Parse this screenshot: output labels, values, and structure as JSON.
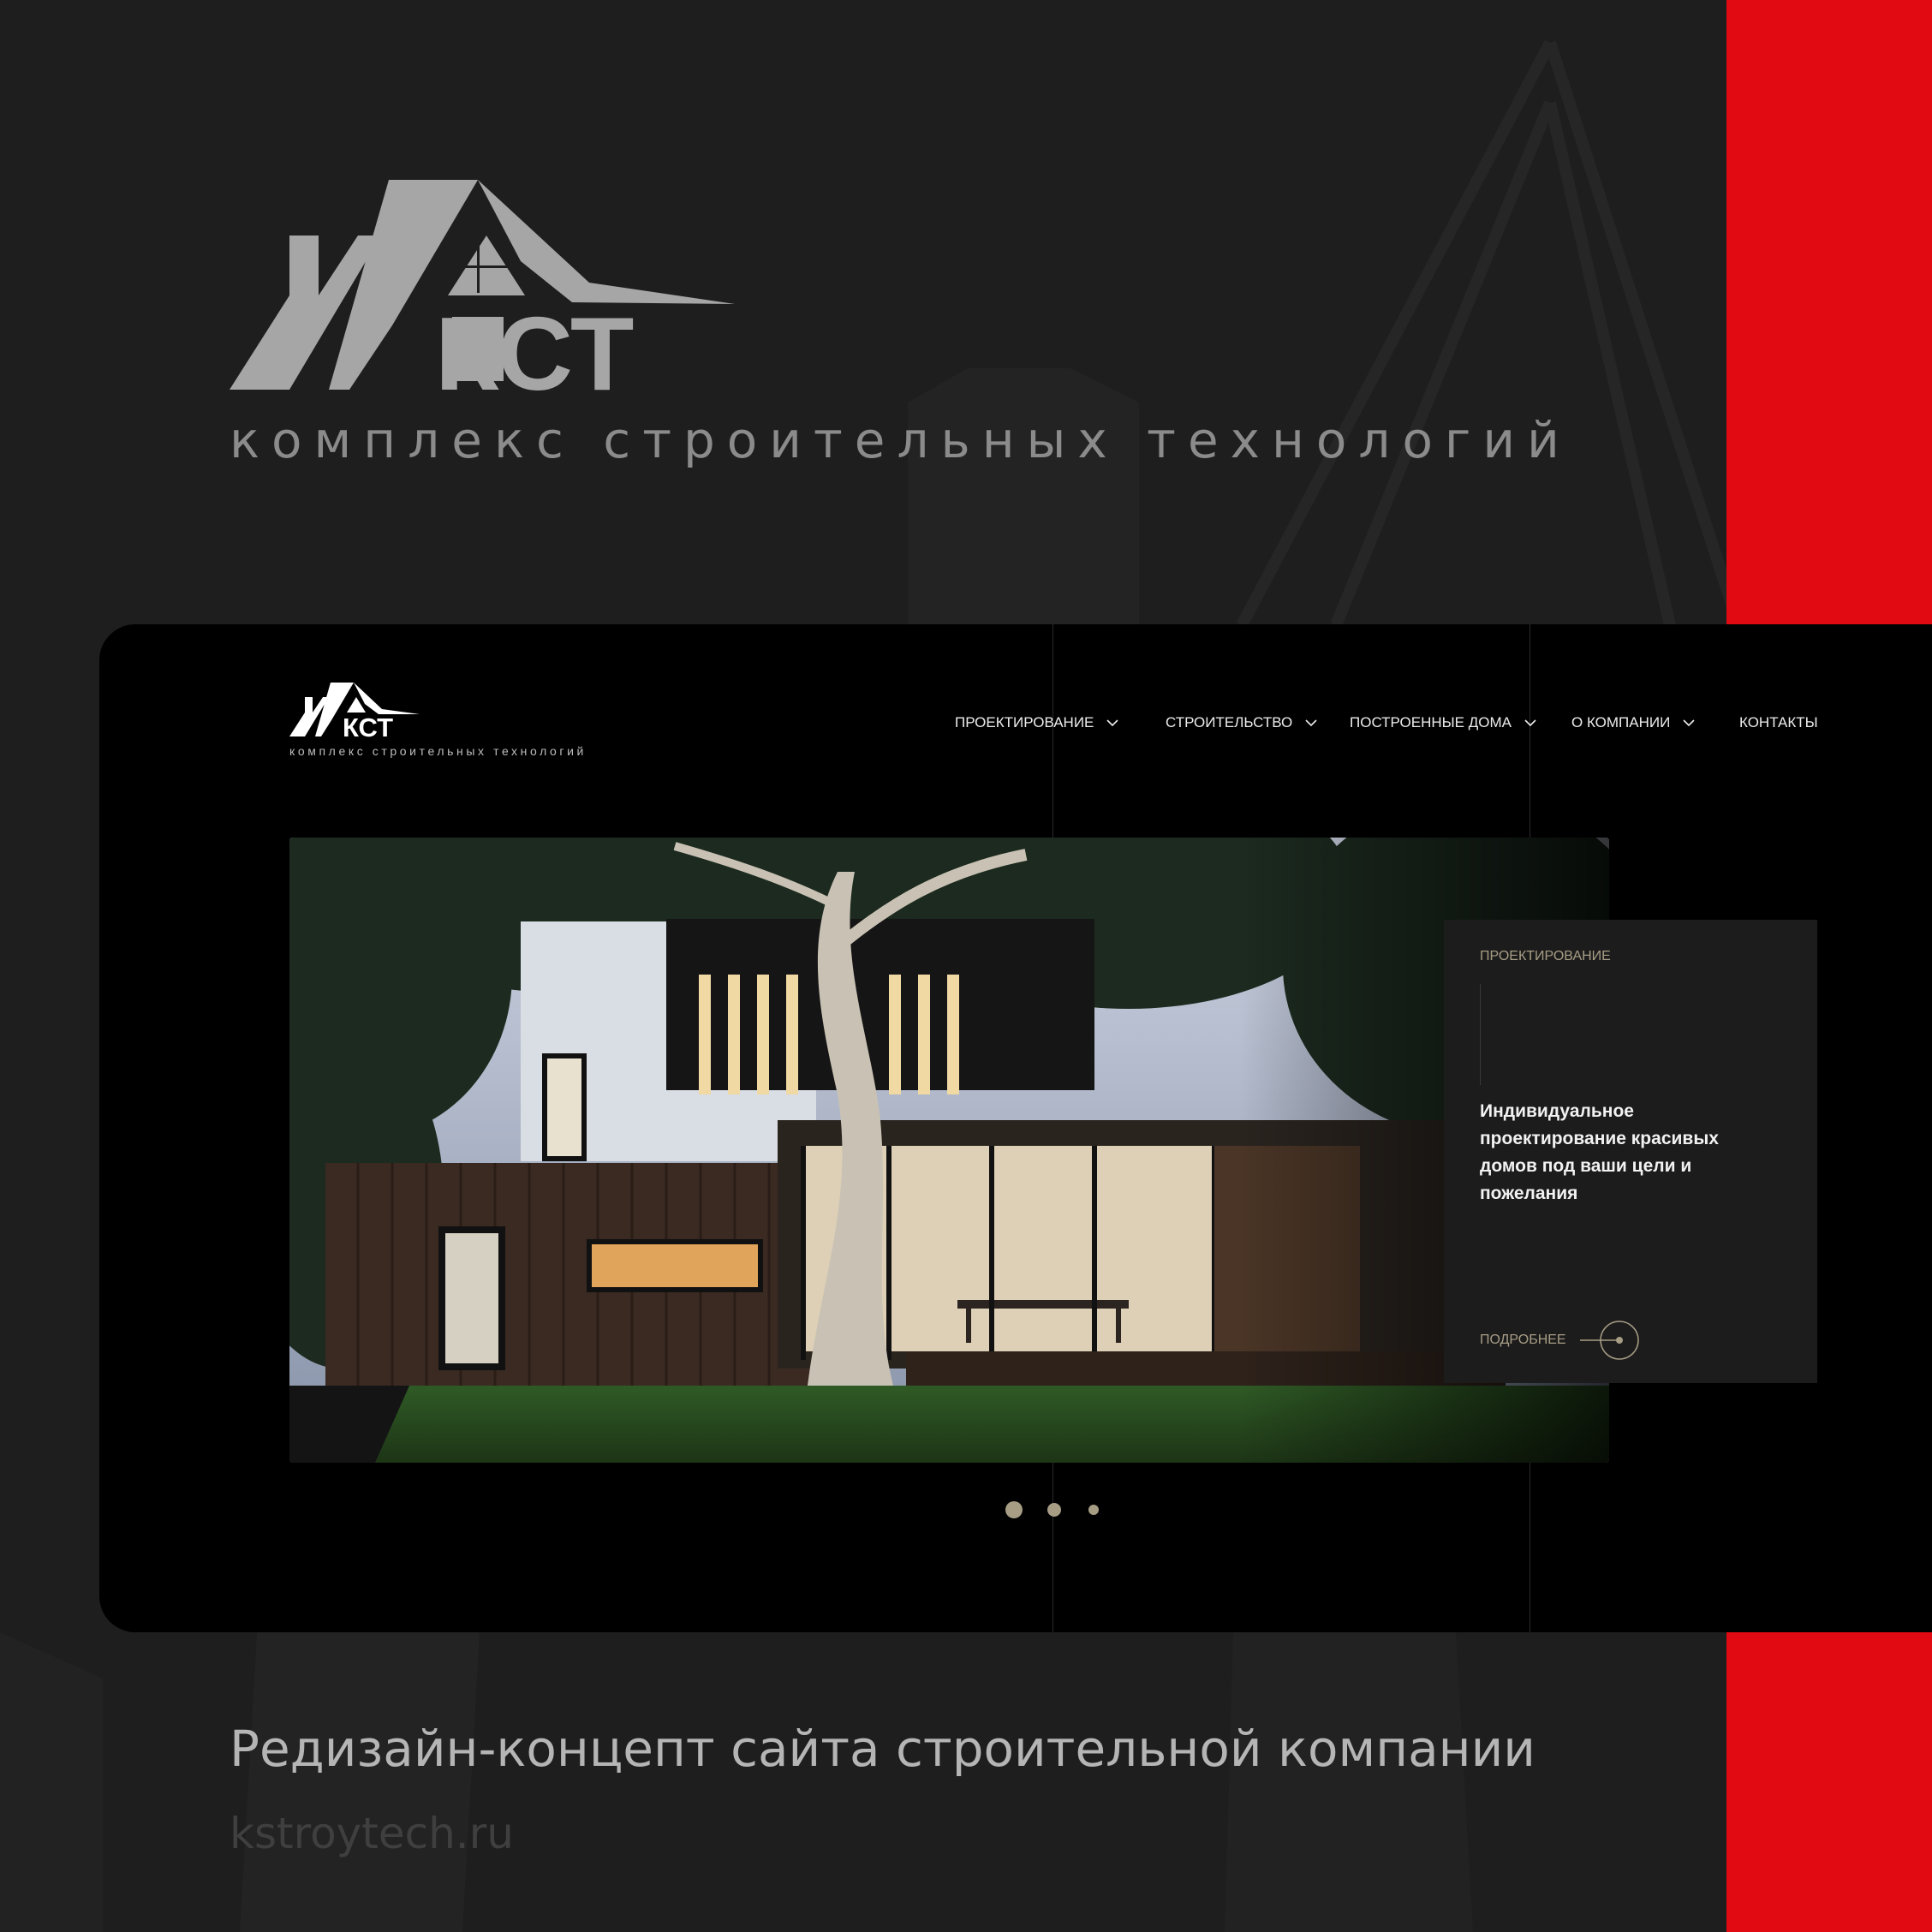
{
  "colors": {
    "background": "#1e1e1e",
    "accent_red": "#e20a12",
    "mockup_bg": "#000000",
    "card_bg": "#1c1c1c",
    "gold": "#a79d85",
    "logo_gray": "#a6a6a6"
  },
  "hero": {
    "logo_text": "КСТ",
    "tagline": "комплекс строительных технологий"
  },
  "site": {
    "logo_text": "КСТ",
    "tagline": "комплекс строительных технологий",
    "nav": [
      {
        "label": "ПРОЕКТИРОВАНИЕ",
        "icon": "chevron-down-icon",
        "has_dropdown": true
      },
      {
        "label": "СТРОИТЕЛЬСТВО",
        "icon": "chevron-down-icon",
        "has_dropdown": true
      },
      {
        "label": "ПОСТРОЕННЫЕ ДОМА",
        "icon": "chevron-down-icon",
        "has_dropdown": true
      },
      {
        "label": "О КОМПАНИИ",
        "icon": "chevron-down-icon",
        "has_dropdown": true
      },
      {
        "label": "КОНТАКТЫ",
        "has_dropdown": false
      }
    ],
    "slider": {
      "image": "modern-house-night-photo",
      "card": {
        "eyebrow": "ПРОЕКТИРОВАНИЕ",
        "heading": "Индивидуальное проектирование красивых домов под ваши цели и пожелания",
        "more_label": "ПОДРОБНЕЕ",
        "more_icon": "arrow-circle-icon"
      },
      "slide_count": 3,
      "active_index": 0
    }
  },
  "footer": {
    "title": "Редизайн-концепт сайта строительной компании",
    "url": "kstroytech.ru"
  }
}
